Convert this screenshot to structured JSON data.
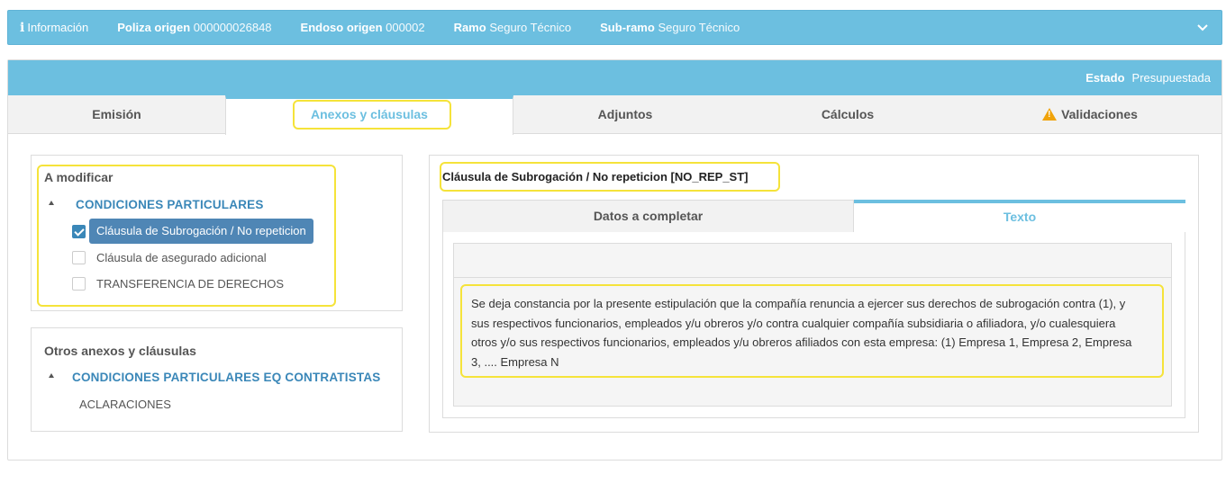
{
  "infobar": {
    "info_label": "Información",
    "poliza_label": "Poliza origen",
    "poliza_value": "000000026848",
    "endoso_label": "Endoso origen",
    "endoso_value": "000002",
    "ramo_label": "Ramo",
    "ramo_value": "Seguro Técnico",
    "subramo_label": "Sub-ramo",
    "subramo_value": "Seguro Técnico"
  },
  "estado": {
    "label": "Estado",
    "value": "Presupuestada"
  },
  "tabs": [
    {
      "label": "Emisión"
    },
    {
      "label": "Anexos y cláusulas",
      "active": true
    },
    {
      "label": "Adjuntos"
    },
    {
      "label": "Cálculos"
    },
    {
      "label": "Validaciones",
      "icon": "warning-icon"
    }
  ],
  "modify_box": {
    "title": "A modificar",
    "group": "CONDICIONES PARTICULARES",
    "items": [
      {
        "label": "Cláusula de Subrogación / No repeticion",
        "checked": true
      },
      {
        "label": "Cláusula de asegurado adicional",
        "checked": false
      },
      {
        "label": "TRANSFERENCIA DE DERECHOS",
        "checked": false
      }
    ]
  },
  "others_box": {
    "title": "Otros anexos y cláusulas",
    "group": "CONDICIONES PARTICULARES EQ CONTRATISTAS",
    "items": [
      {
        "label": "ACLARACIONES"
      }
    ]
  },
  "clause": {
    "title": "Cláusula de Subrogación / No repeticion [NO_REP_ST]",
    "tabs": [
      {
        "label": "Datos a completar"
      },
      {
        "label": "Texto",
        "active": true
      }
    ],
    "text_lines": [
      "Se deja constancia por la presente estipulación que la compañía renuncia a ejercer sus derechos de subrogación contra (1), y",
      "sus respectivos funcionarios, empleados y/u obreros y/o contra cualquier compañía subsidiaria o afiliadora, y/o cualesquiera",
      "otros y/o sus respectivos funcionarios, empleados y/u obreros afiliados con esta empresa: (1) Empresa 1, Empresa 2, Empresa",
      "3, .... Empresa N"
    ]
  },
  "colors": {
    "accent": "#6cbfe0",
    "highlight": "#f5e33a",
    "selected": "#4f86b5",
    "link": "#3a87b8"
  }
}
